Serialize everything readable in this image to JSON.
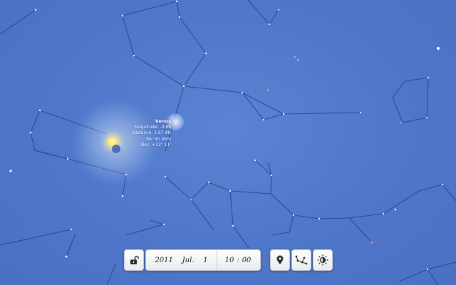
{
  "venus": {
    "name": "Venus",
    "magnitude": "Magnitude: -3.69",
    "distance": "Distance: 1.67 AU",
    "ra": "RA: 5h 45m",
    "dec": "Dec: +23° 11'"
  },
  "datetime": {
    "year": "2011",
    "month": "Jul.",
    "day": "1",
    "hour": "10",
    "minute": "00",
    "separator": ":"
  },
  "toolbar": {
    "lock_icon": "unlock-icon",
    "location_icon": "location-pin-icon",
    "constellation_icon": "constellation-lines-icon",
    "daynight_icon": "sun-brightness-icon"
  },
  "colors": {
    "sky": "#4f77c9",
    "constellation_line": "#2a3f86",
    "sun": "#ffe95a",
    "venus_glow": "#ffffff"
  }
}
